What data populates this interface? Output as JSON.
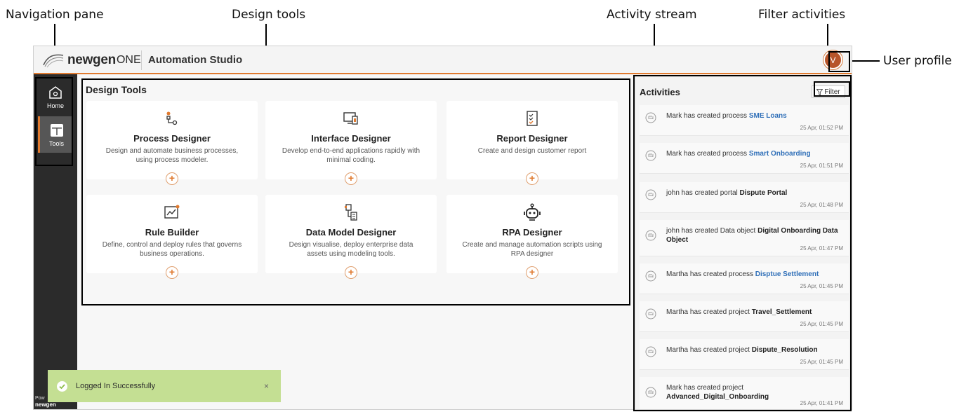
{
  "callouts": {
    "navigation_pane": "Navigation pane",
    "design_tools": "Design tools",
    "activity_stream": "Activity stream",
    "filter_activities": "Filter activities",
    "user_profile": "User profile"
  },
  "header": {
    "logo_bold": "newgen",
    "logo_light": "ONE",
    "studio": "Automation Studio",
    "avatar_initial": "V",
    "accent": "#e07a2f"
  },
  "sidebar": {
    "items": [
      {
        "label": "Home",
        "icon": "home-icon"
      },
      {
        "label": "Tools",
        "icon": "tools-icon"
      }
    ],
    "powered_by": "Pow",
    "powered_logo": "newgen"
  },
  "design_tools": {
    "title": "Design Tools",
    "cards": [
      {
        "title": "Process Designer",
        "desc": "Design and automate business processes, using process modeler.",
        "icon": "process-icon"
      },
      {
        "title": "Interface Designer",
        "desc": "Develop end-to-end applications rapidly with minimal coding.",
        "icon": "interface-icon"
      },
      {
        "title": "Report Designer",
        "desc": "Create and design customer report",
        "icon": "report-icon"
      },
      {
        "title": "Rule Builder",
        "desc": "Define, control and deploy rules that governs business operations.",
        "icon": "rule-icon"
      },
      {
        "title": "Data Model Designer",
        "desc": "Design visualise, deploy enterprise data assets using modeling tools.",
        "icon": "data-model-icon"
      },
      {
        "title": "RPA Designer",
        "desc": "Create and manage automation scripts using RPA designer",
        "icon": "robot-icon"
      }
    ],
    "add_symbol": "+"
  },
  "activities": {
    "title": "Activities",
    "filter_label": "Filter",
    "items": [
      {
        "text": "Mark has created process ",
        "object": "SME Loans",
        "link": true,
        "time": "25 Apr, 01:52 PM"
      },
      {
        "text": "Mark has created process ",
        "object": "Smart Onboarding",
        "link": true,
        "time": "25 Apr, 01:51 PM"
      },
      {
        "text": "john has created portal ",
        "object": "Dispute Portal",
        "link": false,
        "time": "25 Apr, 01:48 PM"
      },
      {
        "text": "john has created Data object ",
        "object": "Digital Onboarding Data Object",
        "link": false,
        "time": "25 Apr, 01:47 PM"
      },
      {
        "text": "Martha has created process ",
        "object": "Disptue Settlement",
        "link": true,
        "time": "25 Apr, 01:45 PM"
      },
      {
        "text": "Martha has created project ",
        "object": "Travel_Settlement",
        "link": false,
        "time": "25 Apr, 01:45 PM"
      },
      {
        "text": "Martha has created project ",
        "object": "Dispute_Resolution",
        "link": false,
        "time": "25 Apr, 01:45 PM"
      },
      {
        "text": "Mark has created project ",
        "object": "Advanced_Digital_Onboarding",
        "link": false,
        "time": "25 Apr, 01:41 PM"
      }
    ]
  },
  "toast": {
    "message": "Logged In Successfully",
    "close": "×"
  }
}
